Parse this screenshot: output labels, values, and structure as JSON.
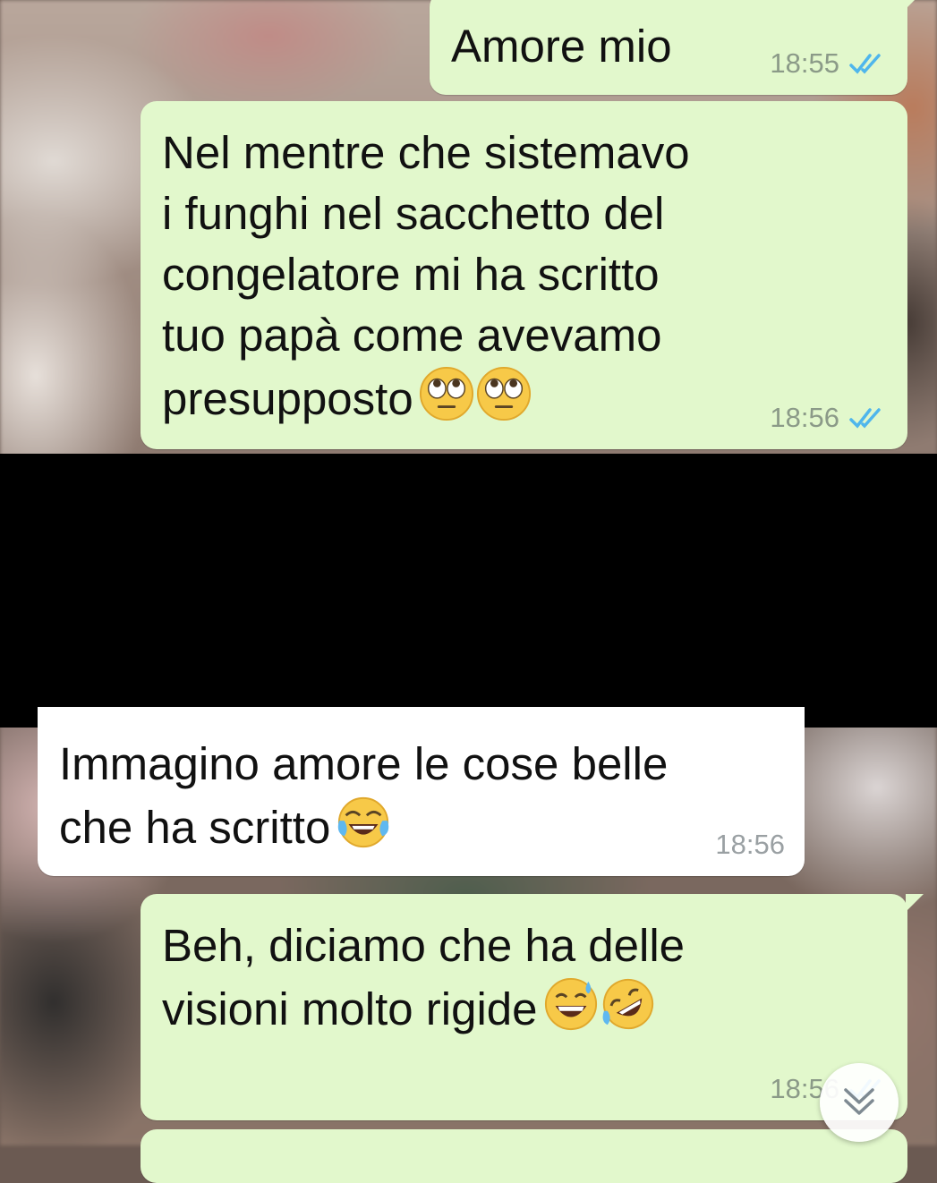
{
  "messages": [
    {
      "direction": "outgoing",
      "text": "Amore mio",
      "time": "18:55",
      "status": "read-double-check-icon"
    },
    {
      "direction": "outgoing",
      "text": "Nel mentre che sistemavo\ni funghi nel sacchetto del\ncongelatore mi ha scritto\ntuo papà come avevamo\npresupposto",
      "emojis": [
        "face-with-rolling-eyes",
        "face-with-rolling-eyes"
      ],
      "time": "18:56",
      "status": "read-double-check-icon"
    },
    {
      "direction": "incoming",
      "text": "Immagino amore le cose belle\nche ha scritto",
      "emojis": [
        "face-with-tears-of-joy"
      ],
      "time": "18:56"
    },
    {
      "direction": "outgoing",
      "text": "Beh, diciamo che ha delle\nvisioni molto rigide",
      "emojis": [
        "grinning-face-with-sweat",
        "rolling-on-the-floor-laughing"
      ],
      "time": "18:56",
      "status": "read-double-check-icon"
    }
  ],
  "colors": {
    "outgoing_bubble": "#e2f8cc",
    "incoming_bubble": "#ffffff",
    "read_ticks": "#4fb6ec",
    "redaction": "#000000"
  },
  "scroll_button": {
    "icon": "double-chevron-down-icon"
  }
}
